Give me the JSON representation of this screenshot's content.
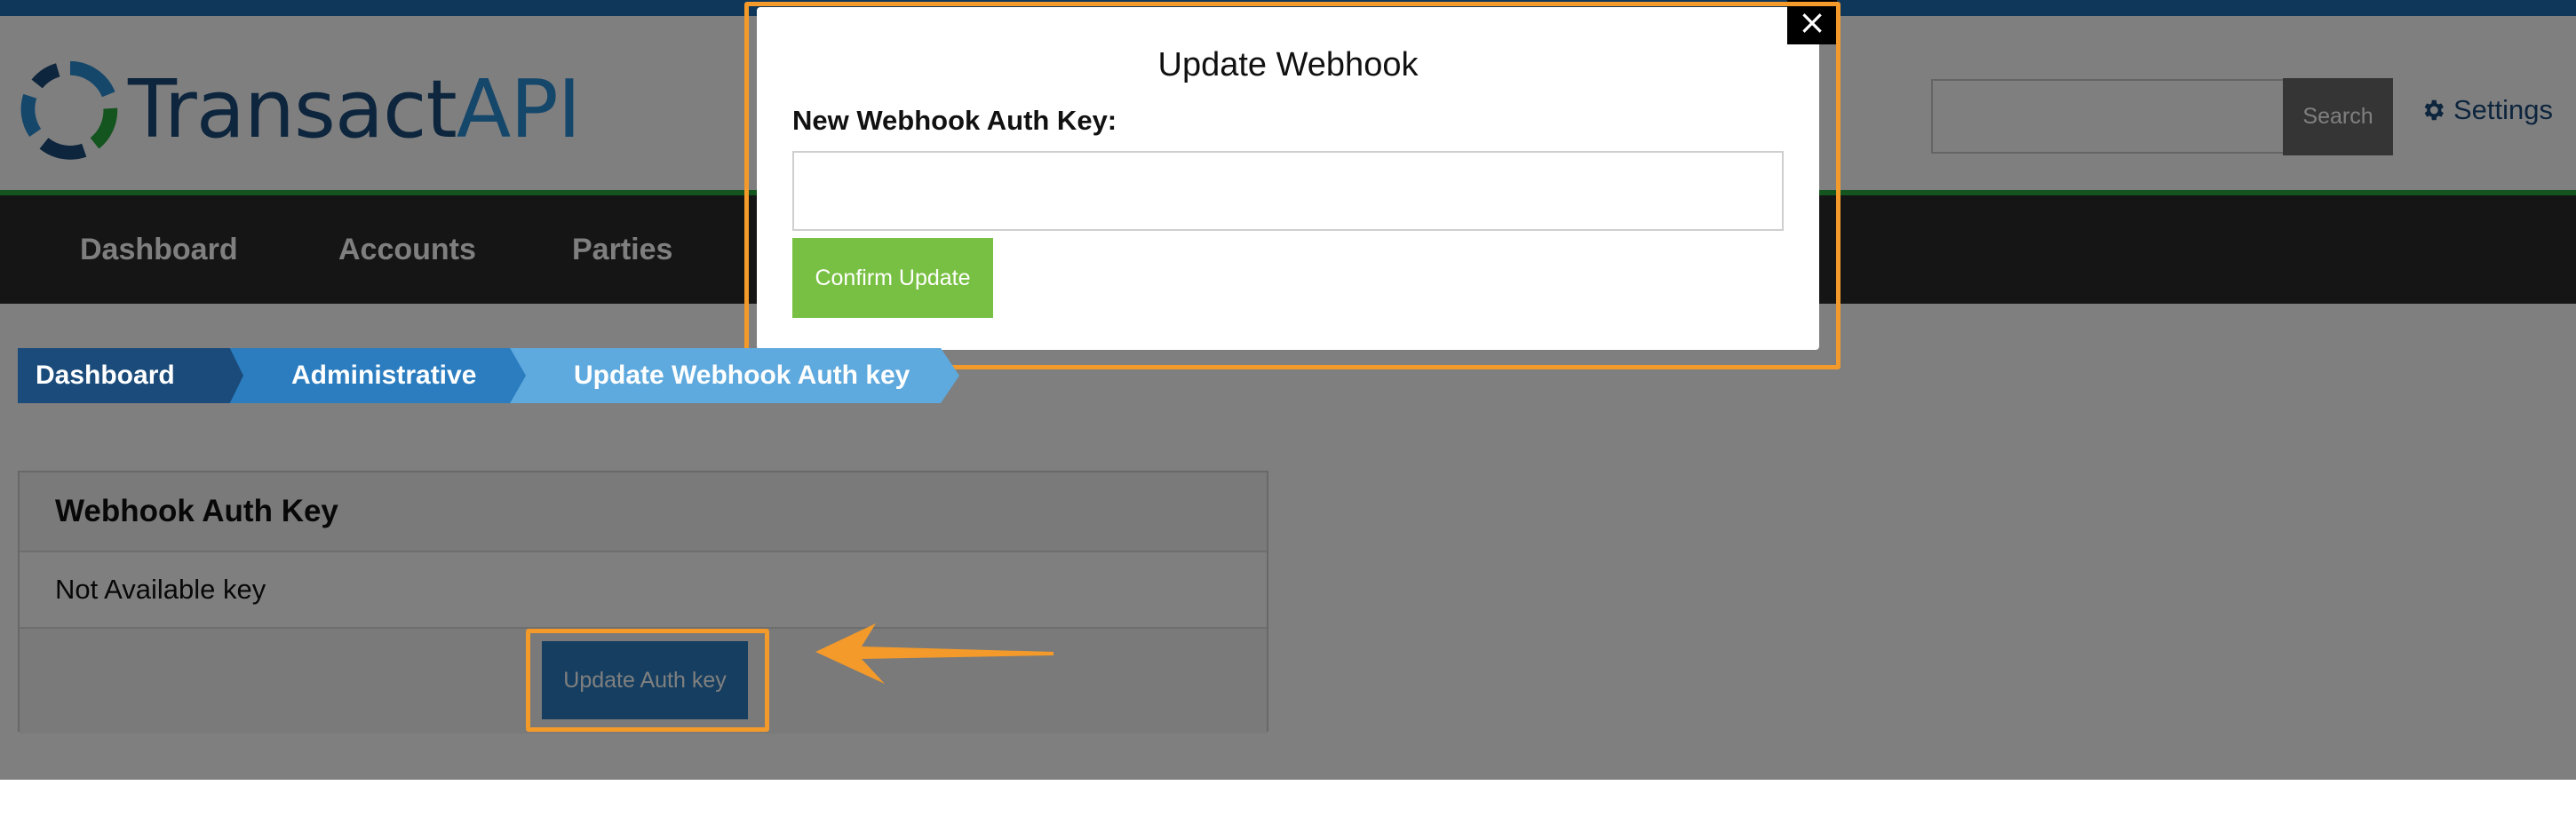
{
  "brand": {
    "logo_part1": "Transact",
    "logo_part2": "API"
  },
  "header": {
    "search_button": "Search",
    "search_value": "",
    "settings_label": "Settings"
  },
  "nav": {
    "items": [
      "Dashboard",
      "Accounts",
      "Parties"
    ]
  },
  "breadcrumb": [
    "Dashboard",
    "Administrative",
    "Update Webhook Auth key"
  ],
  "panel": {
    "title": "Webhook Auth Key",
    "value": "Not Available key",
    "button": "Update Auth key"
  },
  "modal": {
    "title": "Update Webhook",
    "label": "New Webhook Auth Key:",
    "input_value": "",
    "confirm_button": "Confirm Update",
    "close_glyph": "×"
  },
  "colors": {
    "accent_blue": "#2b7dc0",
    "confirm_green": "#78c043",
    "annotation_orange": "#f39a2b"
  },
  "icons": [
    "logo-mark-icon",
    "gear-icon",
    "close-icon",
    "arrow-annotation-icon"
  ]
}
